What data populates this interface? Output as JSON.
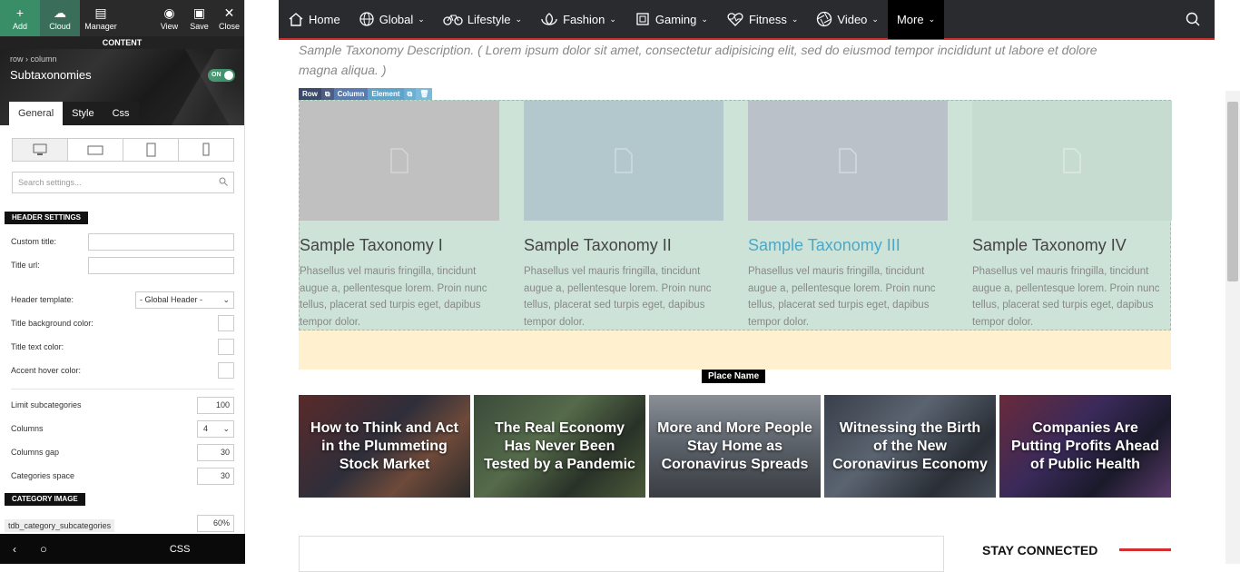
{
  "toolbar": {
    "add": "Add",
    "cloud": "Cloud",
    "manager": "Manager",
    "view": "View",
    "save": "Save",
    "close": "Close"
  },
  "content_label": "CONTENT",
  "panel": {
    "breadcrumb": "row › column",
    "title": "Subtaxonomies",
    "toggle": "ON",
    "tabs": [
      "General",
      "Style",
      "Css"
    ],
    "search_placeholder": "Search settings...",
    "header_section": "HEADER SETTINGS",
    "custom_title": "Custom title:",
    "title_url": "Title url:",
    "header_template": "Header template:",
    "header_template_value": "- Global Header -",
    "title_bg": "Title background color:",
    "title_text": "Title text color:",
    "accent_hover": "Accent hover color:",
    "limit_sub": "Limit subcategories",
    "limit_sub_val": "100",
    "columns": "Columns",
    "columns_val": "4",
    "columns_gap": "Columns gap",
    "columns_gap_val": "30",
    "cat_space": "Categories space",
    "cat_space_val": "30",
    "category_section": "CATEGORY IMAGE",
    "class_tag": "tdb_category_subcategories",
    "pct_val": "60%",
    "css_btn": "CSS"
  },
  "nav": {
    "items": [
      "Home",
      "Global",
      "Lifestyle",
      "Fashion",
      "Gaming",
      "Fitness",
      "Video",
      "More"
    ]
  },
  "main": {
    "description": "Sample Taxonomy Description. ( Lorem ipsum dolor sit amet, consectetur adipisicing elit, sed do eiusmod tempor incididunt ut labore et dolore magna aliqua. )",
    "editbar": [
      "Row",
      "Column",
      "Element"
    ],
    "taxonomies": [
      {
        "title": "Sample Taxonomy I",
        "desc": "Phasellus vel mauris fringilla, tincidunt augue a, pellentesque lorem. Proin nunc tellus, placerat sed turpis eget, dapibus tempor dolor."
      },
      {
        "title": "Sample Taxonomy II",
        "desc": "Phasellus vel mauris fringilla, tincidunt augue a, pellentesque lorem. Proin nunc tellus, placerat sed turpis eget, dapibus tempor dolor."
      },
      {
        "title": "Sample Taxonomy III",
        "desc": "Phasellus vel mauris fringilla, tincidunt augue a, pellentesque lorem. Proin nunc tellus, placerat sed turpis eget, dapibus tempor dolor."
      },
      {
        "title": "Sample Taxonomy IV",
        "desc": "Phasellus vel mauris fringilla, tincidunt augue a, pellentesque lorem. Proin nunc tellus, placerat sed turpis eget, dapibus tempor dolor."
      }
    ],
    "place_name": "Place Name",
    "posts": [
      "How to Think and Act in the Plummeting Stock Market",
      "The Real Economy Has Never Been Tested by a Pandemic",
      "More and More People Stay Home as Coronavirus Spreads",
      "Witnessing the Birth of the New Coronavirus Economy",
      "Companies Are Putting Profits Ahead of Public Health"
    ],
    "stay_connected": "STAY CONNECTED"
  },
  "colors": {
    "accent": "#d32f2f",
    "green": "#3a8e67",
    "highlight": "#4aa8c8"
  }
}
